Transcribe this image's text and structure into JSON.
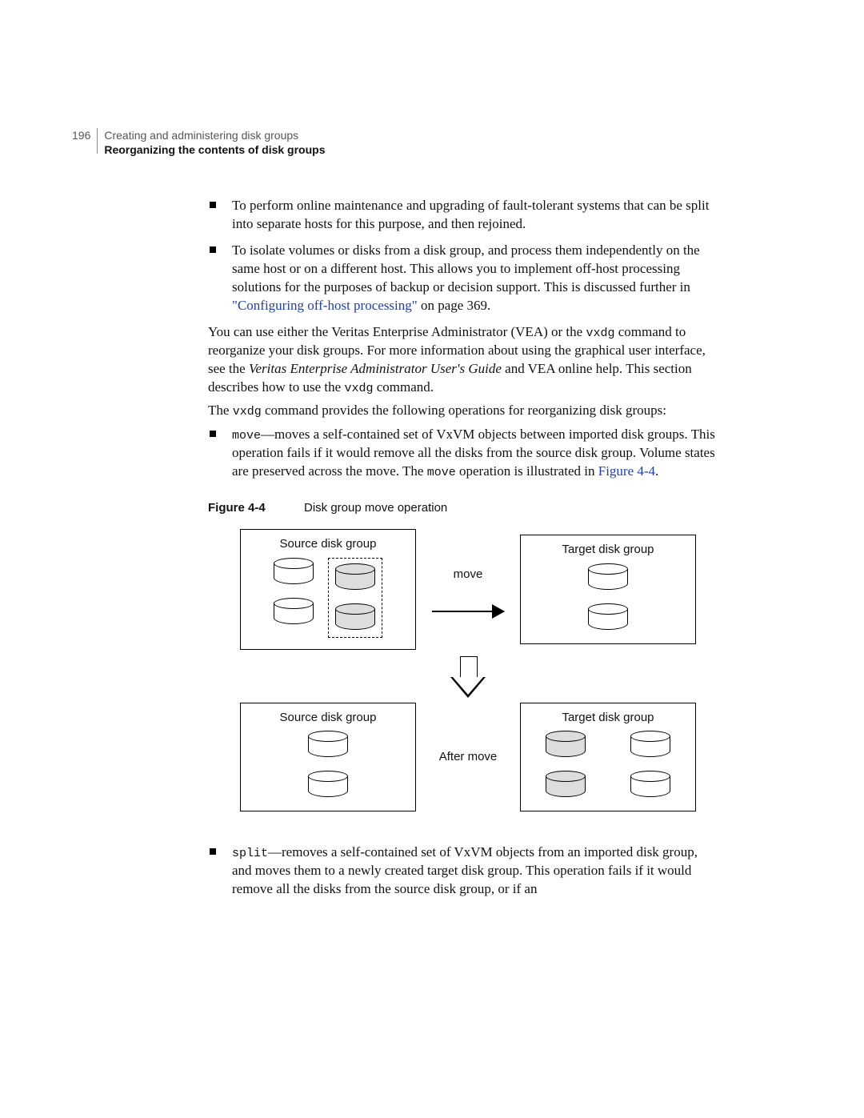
{
  "header": {
    "page_number": "196",
    "chapter": "Creating and administering disk groups",
    "section": "Reorganizing the contents of disk groups"
  },
  "bullets_top": [
    "To perform online maintenance and upgrading of fault-tolerant systems that can be split into separate hosts for this purpose, and then rejoined.",
    "To isolate volumes or disks from a disk group, and process them independently on the same host or on a different host. This allows you to implement off-host processing solutions for the purposes of backup or decision support. This is discussed further in "
  ],
  "link1": "\"Configuring off-host processing\"",
  "link1_suffix": " on page 369.",
  "para1_pre": "You can use either the Veritas Enterprise Administrator (VEA) or the ",
  "para1_code": "vxdg",
  "para1_post": " command to reorganize your disk groups. For more information about using the graphical user interface, see the ",
  "para1_italic": "Veritas Enterprise Administrator User's Guide",
  "para1_end": " and VEA online help. This section describes how to use the ",
  "para1_code2": "vxdg",
  "para1_end2": " command.",
  "para2_pre": "The ",
  "para2_code": "vxdg",
  "para2_post": " command provides the following operations for reorganizing disk groups:",
  "op1_code": "move",
  "op1_text": "—moves a self-contained set of VxVM objects between imported disk groups. This operation fails if it would remove all the disks from the source disk group. Volume states are preserved across the move. The ",
  "op1_code2": "move",
  "op1_text2": " operation is illustrated in ",
  "op1_link": "Figure 4-4",
  "op1_end": ".",
  "figure": {
    "number": "Figure 4-4",
    "title": "Disk group move operation",
    "source_label": "Source disk group",
    "target_label": "Target disk group",
    "move_label": "move",
    "after_label": "After move"
  },
  "op2_code": "split",
  "op2_text": "—removes a self-contained set of VxVM objects from an imported disk group, and moves them to a newly created target disk group. This operation fails if it would remove all the disks from the source disk group, or if an"
}
